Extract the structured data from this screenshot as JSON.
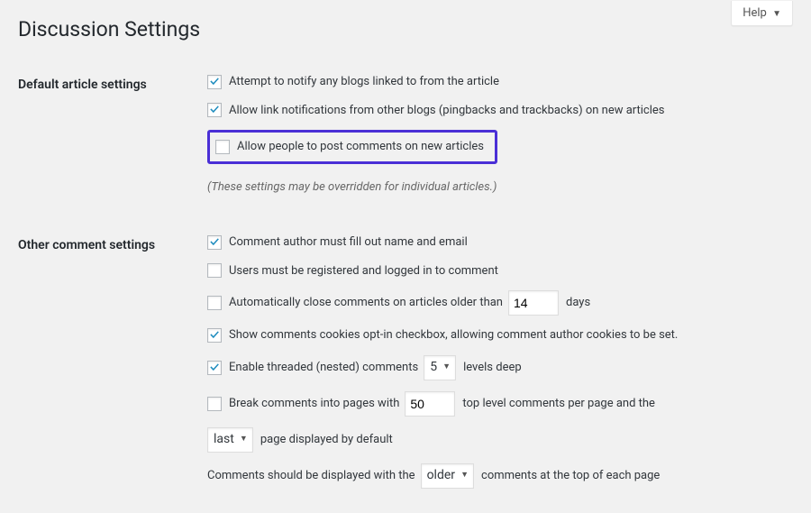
{
  "help_label": "Help",
  "page_title": "Discussion Settings",
  "sections": {
    "default_article": {
      "header": "Default article settings",
      "notify_blogs": "Attempt to notify any blogs linked to from the article",
      "allow_pingbacks": "Allow link notifications from other blogs (pingbacks and trackbacks) on new articles",
      "allow_comments": "Allow people to post comments on new articles",
      "hint": "(These settings may be overridden for individual articles.)"
    },
    "other_comment": {
      "header": "Other comment settings",
      "name_email": "Comment author must fill out name and email",
      "registered": "Users must be registered and logged in to comment",
      "auto_close_pre": "Automatically close comments on articles older than",
      "auto_close_days_value": "14",
      "auto_close_post": "days",
      "cookies_optin": "Show comments cookies opt-in checkbox, allowing comment author cookies to be set.",
      "threaded_pre": "Enable threaded (nested) comments",
      "threaded_levels_value": "5",
      "threaded_post": "levels deep",
      "break_pages_pre": "Break comments into pages with",
      "break_pages_value": "50",
      "break_pages_mid": "top level comments per page and the",
      "break_pages_order_value": "last",
      "break_pages_post": "page displayed by default",
      "display_order_pre": "Comments should be displayed with the",
      "display_order_value": "older",
      "display_order_post": "comments at the top of each page"
    }
  }
}
